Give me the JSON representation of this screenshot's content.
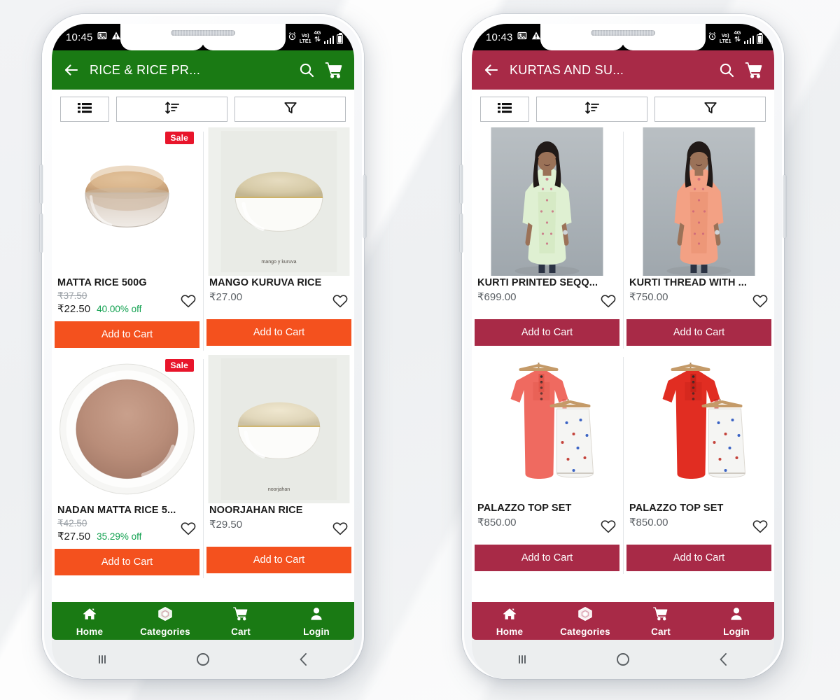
{
  "phones": [
    {
      "id": "left",
      "theme": {
        "primary": "#1a7a14",
        "cta": "#f4511e"
      },
      "status": {
        "time": "10:45",
        "volte": "Vo) LTE1",
        "network": "4G"
      },
      "appbar": {
        "title": "RICE & RICE PR...",
        "back_icon": "back-arrow-icon",
        "search_icon": "search-icon",
        "cart_icon": "cart-icon"
      },
      "toolbar": {
        "view_icon": "list-view-icon",
        "sort_icon": "sort-icon",
        "filter_icon": "filter-funnel-icon"
      },
      "products": [
        {
          "name": "MATTA RICE 500G",
          "mrp": "₹37.50",
          "price": "₹22.50",
          "discount": "40.00% off",
          "badge": "Sale",
          "cta": "Add to Cart",
          "art": "matta-rice-glass-bowl",
          "watermark": ""
        },
        {
          "name": "MANGO KURUVA RICE",
          "mrp": "",
          "price": "₹27.00",
          "discount": "",
          "badge": "",
          "cta": "Add to Cart",
          "art": "mango-kuruva-white-bowl",
          "watermark": "mango y kuruva"
        },
        {
          "name": "NADAN MATTA RICE 5...",
          "mrp": "₹42.50",
          "price": "₹27.50",
          "discount": "35.29% off",
          "badge": "Sale",
          "cta": "Add to Cart",
          "art": "nadan-matta-rice-plate",
          "watermark": ""
        },
        {
          "name": "NOORJAHAN RICE",
          "mrp": "",
          "price": "₹29.50",
          "discount": "",
          "badge": "",
          "cta": "Add to Cart",
          "art": "noorjahan-white-bowl",
          "watermark": "noorjahan"
        }
      ],
      "bottomnav": [
        {
          "label": "Home",
          "icon": "home-icon"
        },
        {
          "label": "Categories",
          "icon": "categories-cube-icon"
        },
        {
          "label": "Cart",
          "icon": "cart-icon"
        },
        {
          "label": "Login",
          "icon": "user-icon"
        }
      ]
    },
    {
      "id": "right",
      "theme": {
        "primary": "#a82a47",
        "cta": "#a82a47"
      },
      "status": {
        "time": "10:43",
        "volte": "Vo) LTE1",
        "network": "4G"
      },
      "appbar": {
        "title": "KURTAS AND SU...",
        "back_icon": "back-arrow-icon",
        "search_icon": "search-icon",
        "cart_icon": "cart-icon"
      },
      "toolbar": {
        "view_icon": "list-view-icon",
        "sort_icon": "sort-icon",
        "filter_icon": "filter-funnel-icon"
      },
      "products": [
        {
          "name": "KURTI PRINTED SEQQ...",
          "mrp": "",
          "price": "₹699.00",
          "discount": "",
          "badge": "",
          "cta": "Add to Cart",
          "art": "model-mint-kurti",
          "watermark": ""
        },
        {
          "name": "KURTI THREAD WITH ...",
          "mrp": "",
          "price": "₹750.00",
          "discount": "",
          "badge": "",
          "cta": "Add to Cart",
          "art": "model-peach-kurti",
          "watermark": ""
        },
        {
          "name": "PALAZZO TOP SET",
          "mrp": "",
          "price": "₹850.00",
          "discount": "",
          "badge": "",
          "cta": "Add to Cart",
          "art": "salmon-kurta-hanger-set",
          "watermark": ""
        },
        {
          "name": "PALAZZO TOP SET",
          "mrp": "",
          "price": "₹850.00",
          "discount": "",
          "badge": "",
          "cta": "Add to Cart",
          "art": "red-kurta-hanger-set",
          "watermark": ""
        }
      ],
      "bottomnav": [
        {
          "label": "Home",
          "icon": "home-icon"
        },
        {
          "label": "Categories",
          "icon": "categories-cube-icon"
        },
        {
          "label": "Cart",
          "icon": "cart-icon"
        },
        {
          "label": "Login",
          "icon": "user-icon"
        }
      ]
    }
  ],
  "androidnav": {
    "recents_icon": "recents-icon",
    "home_icon": "home-circle-icon",
    "back_icon": "back-chevron-icon"
  }
}
